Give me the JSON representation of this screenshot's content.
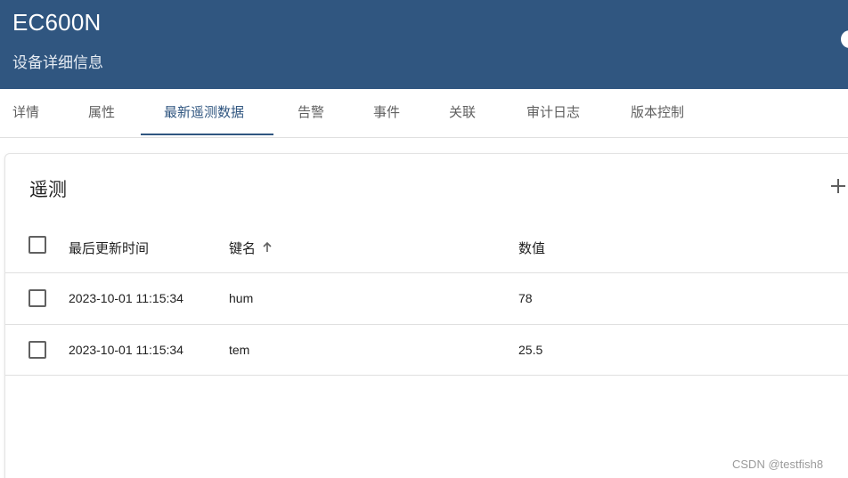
{
  "header": {
    "title": "EC600N",
    "subtitle": "设备详细信息"
  },
  "tabs": [
    {
      "label": "详情"
    },
    {
      "label": "属性"
    },
    {
      "label": "最新遥测数据",
      "active": true
    },
    {
      "label": "告警"
    },
    {
      "label": "事件"
    },
    {
      "label": "关联"
    },
    {
      "label": "审计日志"
    },
    {
      "label": "版本控制"
    }
  ],
  "card": {
    "title": "遥测",
    "add_icon": "plus-icon",
    "columns": {
      "last_update": "最后更新时间",
      "key": "键名",
      "value": "数值"
    },
    "sort_icon": "arrow-up-icon",
    "rows": [
      {
        "time": "2023-10-01 11:15:34",
        "key": "hum",
        "value": "78"
      },
      {
        "time": "2023-10-01 11:15:34",
        "key": "tem",
        "value": "25.5"
      }
    ]
  },
  "watermark": "CSDN @testfish8",
  "colors": {
    "header_bg": "#305680",
    "accent": "#305680"
  }
}
